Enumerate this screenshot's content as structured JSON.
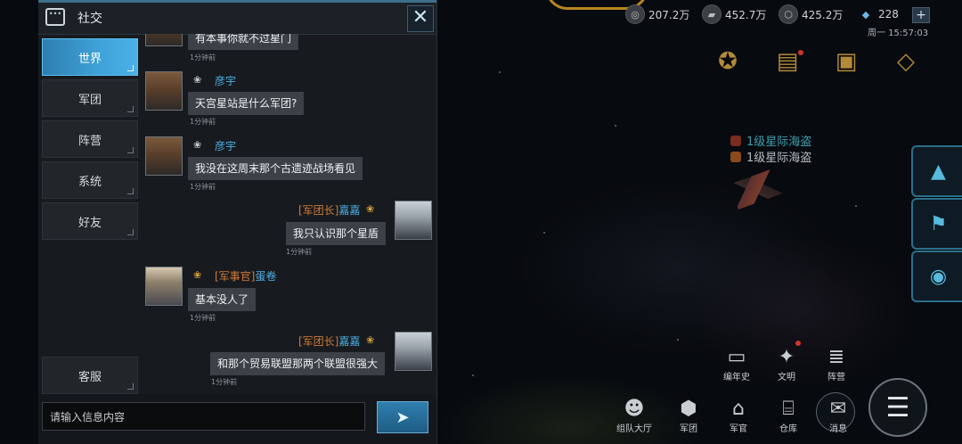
{
  "resources": [
    {
      "icon": "gold-coin-icon",
      "value": "207.2万"
    },
    {
      "icon": "metal-icon",
      "value": "452.7万"
    },
    {
      "icon": "crystal-icon",
      "value": "425.2万"
    },
    {
      "icon": "diamond-icon",
      "value": "228"
    }
  ],
  "clock": "周一 15:57:03",
  "enemies": [
    {
      "label": "1级星际海盗",
      "color": "#3fa0b0"
    },
    {
      "label": "1级星际海盗",
      "color": "#b8bec4"
    }
  ],
  "bottom_menu": {
    "row1": [
      "编年史",
      "文明",
      "阵营"
    ],
    "row2": [
      "组队大厅",
      "军团",
      "军官",
      "仓库",
      "消息"
    ]
  },
  "panel": {
    "title": "社交",
    "close": "✕",
    "tabs": [
      "世界",
      "军团",
      "阵营",
      "系统",
      "好友"
    ],
    "tab_service": "客服",
    "input_placeholder": "请输入信息内容"
  },
  "messages": [
    {
      "side": "left",
      "name": "",
      "text": "有本事你就不过星门",
      "time": "1分钟前"
    },
    {
      "side": "left",
      "name": "彦宇",
      "rank": "",
      "text": "天宫星站是什么军团?",
      "time": "1分钟前"
    },
    {
      "side": "left",
      "name": "彦宇",
      "rank": "",
      "text": "我没在这周末那个古遗迹战场看见",
      "time": "1分钟前"
    },
    {
      "side": "right",
      "name": "嘉嘉",
      "rank": "[军团长]",
      "text": "我只认识那个星盾",
      "time": "1分钟前"
    },
    {
      "side": "left",
      "name": "蛋卷",
      "rank": "[军事官]",
      "text": "基本没人了",
      "time": "1分钟前"
    },
    {
      "side": "right",
      "name": "嘉嘉",
      "rank": "[军团长]",
      "text": "和那个贸易联盟那两个联盟很强大",
      "time": "1分钟前"
    }
  ]
}
